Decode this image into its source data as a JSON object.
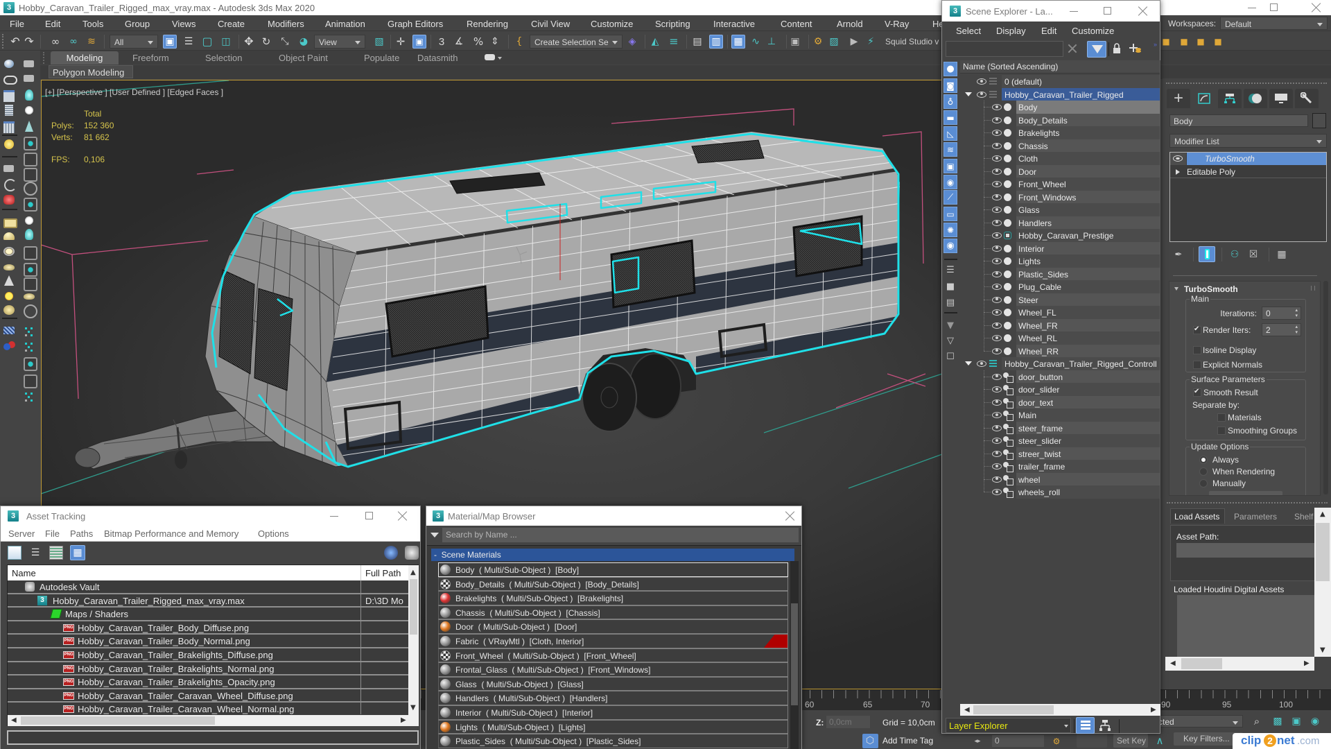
{
  "app": {
    "title": "Hobby_Caravan_Trailer_Rigged_max_vray.max - Autodesk 3ds Max 2020"
  },
  "menu": {
    "items": [
      "File",
      "Edit",
      "Tools",
      "Group",
      "Views",
      "Create",
      "Modifiers",
      "Animation",
      "Graph Editors",
      "Rendering",
      "Civil View",
      "Customize",
      "Scripting",
      "Interactive",
      "Content",
      "Arnold",
      "V-Ray",
      "Help"
    ]
  },
  "workspaces": {
    "label": "Workspaces:",
    "value": "Default"
  },
  "main_toolbar": {
    "selection_filter": "All",
    "reference_coordinate_system": "View",
    "named_selection_set": "Create Selection Se",
    "plugin_label": "Squid Studio v",
    "icons": [
      "undo-icon",
      "redo-icon",
      "select-and-link-icon",
      "unlink-selection-icon",
      "bind-to-space-warp-icon",
      "select-object-icon",
      "select-by-name-icon",
      "rectangular-selection-region-icon",
      "window-crossing-icon",
      "select-and-move-icon",
      "select-and-rotate-icon",
      "select-and-scale-icon",
      "select-and-place-icon",
      "use-pivot-point-center-icon",
      "select-and-manipulate-icon",
      "keyboard-shortcut-override-icon",
      "snaps-toggle-icon",
      "angle-snap-icon",
      "percent-snap-icon",
      "spinner-snap-icon",
      "edit-named-selection-sets-icon",
      "named-selection-icon",
      "mirror-icon",
      "align-icon",
      "toggle-scene-explorer-icon",
      "toggle-layer-explorer-icon",
      "toggle-ribbon-icon",
      "curve-editor-icon",
      "schematic-view-icon",
      "material-editor-icon",
      "render-setup-icon",
      "rendered-frame-window-icon",
      "render-production-icon",
      "render-iterative-icon"
    ],
    "active_icons": [
      "select-object-icon",
      "keyboard-shortcut-override-icon",
      "toggle-layer-explorer-icon",
      "toggle-ribbon-icon"
    ]
  },
  "ribbon": {
    "tabs": [
      "Modeling",
      "Freeform",
      "Selection",
      "Object Paint",
      "Populate",
      "Datasmith"
    ],
    "active_tab": "Modeling",
    "panel_label": "Polygon Modeling"
  },
  "viewport": {
    "label": "[+] [Perspective ] [User Defined ] [Edged Faces ]",
    "stats": {
      "header": "Total",
      "polys_label": "Polys:",
      "polys": "152 360",
      "verts_label": "Verts:",
      "verts": "81 662",
      "fps_label": "FPS:",
      "fps": "0,106"
    },
    "colors": {
      "stats_text": "#d6c44c",
      "selection_outline": "#1fe0e8",
      "active_border": "#c09a34"
    }
  },
  "scene_explorer": {
    "title": "Scene Explorer - La...",
    "menu": [
      "Select",
      "Display",
      "Edit",
      "Customize"
    ],
    "search_value": "",
    "column_header": "Name (Sorted Ascending)",
    "tree": [
      {
        "name": "0 (default)",
        "type": "layer"
      },
      {
        "name": "Hobby_Caravan_Trailer_Rigged",
        "type": "layer",
        "expanded": true,
        "selected": true
      },
      {
        "name": "Body",
        "type": "geometry",
        "highlighted": true
      },
      {
        "name": "Body_Details",
        "type": "geometry"
      },
      {
        "name": "Brakelights",
        "type": "geometry"
      },
      {
        "name": "Chassis",
        "type": "geometry"
      },
      {
        "name": "Cloth",
        "type": "geometry"
      },
      {
        "name": "Door",
        "type": "geometry"
      },
      {
        "name": "Front_Wheel",
        "type": "geometry"
      },
      {
        "name": "Front_Windows",
        "type": "geometry"
      },
      {
        "name": "Glass",
        "type": "geometry"
      },
      {
        "name": "Handlers",
        "type": "geometry"
      },
      {
        "name": "Hobby_Caravan_Prestige",
        "type": "group"
      },
      {
        "name": "Interior",
        "type": "geometry"
      },
      {
        "name": "Lights",
        "type": "geometry"
      },
      {
        "name": "Plastic_Sides",
        "type": "geometry"
      },
      {
        "name": "Plug_Cable",
        "type": "geometry"
      },
      {
        "name": "Steer",
        "type": "geometry"
      },
      {
        "name": "Wheel_FL",
        "type": "geometry"
      },
      {
        "name": "Wheel_FR",
        "type": "geometry"
      },
      {
        "name": "Wheel_RL",
        "type": "geometry"
      },
      {
        "name": "Wheel_RR",
        "type": "geometry"
      },
      {
        "name": "Hobby_Caravan_Trailer_Rigged_Controll",
        "type": "layer",
        "expanded": true
      },
      {
        "name": "door_button",
        "type": "helper"
      },
      {
        "name": "door_slider",
        "type": "helper"
      },
      {
        "name": "door_text",
        "type": "helper"
      },
      {
        "name": "Main",
        "type": "helper"
      },
      {
        "name": "steer_frame",
        "type": "helper"
      },
      {
        "name": "steer_slider",
        "type": "helper"
      },
      {
        "name": "streer_twist",
        "type": "helper"
      },
      {
        "name": "trailer_frame",
        "type": "helper"
      },
      {
        "name": "wheel",
        "type": "helper"
      },
      {
        "name": "wheels_roll",
        "type": "helper"
      }
    ],
    "footer": {
      "explorer_mode": "Layer Explorer",
      "mode_text_color": "#e8e810"
    }
  },
  "command_panel": {
    "tabs": [
      "create",
      "modify",
      "hierarchy",
      "motion",
      "display",
      "utilities"
    ],
    "active_tab": "modify",
    "object_name": "Body",
    "modifier_list": "Modifier List",
    "stack": [
      {
        "name": "TurboSmooth",
        "selected": true
      },
      {
        "name": "Editable Poly",
        "selected": false
      }
    ],
    "turbosmooth": {
      "title": "TurboSmooth",
      "main_label": "Main",
      "iterations_label": "Iterations:",
      "iterations": "0",
      "render_iters_label": "Render Iters:",
      "render_iters": "2",
      "render_iters_enabled": true,
      "isoline_label": "Isoline Display",
      "isoline": false,
      "explicit_normals_label": "Explicit Normals",
      "explicit_normals": false,
      "surface_label": "Surface Parameters",
      "smooth_result_label": "Smooth Result",
      "smooth_result": true,
      "separate_by_label": "Separate by:",
      "materials_label": "Materials",
      "materials": false,
      "smoothing_groups_label": "Smoothing Groups",
      "smoothing_groups": false,
      "update_label": "Update Options",
      "update_options": [
        {
          "label": "Always",
          "selected": true
        },
        {
          "label": "When Rendering",
          "selected": false
        },
        {
          "label": "Manually",
          "selected": false
        }
      ]
    }
  },
  "houdini_engine": {
    "tabs": [
      "Load Assets",
      "Parameters",
      "Shelf"
    ],
    "active_tab": "Load Assets",
    "asset_path_label": "Asset Path:",
    "asset_path_value": "",
    "loaded_assets_label": "Loaded Houdini Digital Assets"
  },
  "timeline": {
    "visible_ticks": [
      "60",
      "65",
      "70",
      "90",
      "95",
      "100"
    ]
  },
  "status_bar": {
    "z_label": "Z:",
    "z_value": "0,0cm",
    "grid": "Grid = 10,0cm",
    "add_time_tag": "Add Time Tag",
    "current_frame": "0",
    "set_key": "Set Key",
    "key_filters": "Key Filters...",
    "key_mode": "Selected"
  },
  "asset_tracking": {
    "title": "Asset Tracking",
    "menu": [
      "Server",
      "File",
      "Paths",
      "Bitmap Performance and Memory",
      "Options"
    ],
    "columns": [
      "Name",
      "Full Path"
    ],
    "rows": [
      {
        "name": "Autodesk Vault",
        "path": "",
        "icon": "vault"
      },
      {
        "name": "Hobby_Caravan_Trailer_Rigged_max_vray.max",
        "path": "D:\\3D Mo",
        "icon": "max-file"
      },
      {
        "name": "Maps / Shaders",
        "path": "",
        "icon": "maps"
      },
      {
        "name": "Hobby_Caravan_Trailer_Body_Diffuse.png",
        "path": "",
        "icon": "png"
      },
      {
        "name": "Hobby_Caravan_Trailer_Body_Normal.png",
        "path": "",
        "icon": "png"
      },
      {
        "name": "Hobby_Caravan_Trailer_Brakelights_Diffuse.png",
        "path": "",
        "icon": "png"
      },
      {
        "name": "Hobby_Caravan_Trailer_Brakelights_Normal.png",
        "path": "",
        "icon": "png"
      },
      {
        "name": "Hobby_Caravan_Trailer_Brakelights_Opacity.png",
        "path": "",
        "icon": "png"
      },
      {
        "name": "Hobby_Caravan_Trailer_Caravan_Wheel_Diffuse.png",
        "path": "",
        "icon": "png"
      },
      {
        "name": "Hobby_Caravan_Trailer_Caravan_Wheel_Normal.png",
        "path": "",
        "icon": "png"
      }
    ],
    "status": ""
  },
  "material_browser": {
    "title": "Material/Map Browser",
    "search_placeholder": "Search by Name ...",
    "group_label": "-  Scene Materials",
    "materials": [
      {
        "text": "Body  ( Multi/Sub-Object )  [Body]",
        "marker": false
      },
      {
        "text": "Body_Details  ( Multi/Sub-Object )  [Body_Details]",
        "marker": false
      },
      {
        "text": "Brakelights  ( Multi/Sub-Object )  [Brakelights]",
        "marker": false
      },
      {
        "text": "Chassis  ( Multi/Sub-Object )  [Chassis]",
        "marker": false
      },
      {
        "text": "Door  ( Multi/Sub-Object )  [Door]",
        "marker": false
      },
      {
        "text": "Fabric  ( VRayMtl )  [Cloth, Interior]",
        "marker": true
      },
      {
        "text": "Front_Wheel  ( Multi/Sub-Object )  [Front_Wheel]",
        "marker": false
      },
      {
        "text": "Frontal_Glass  ( Multi/Sub-Object )  [Front_Windows]",
        "marker": false
      },
      {
        "text": "Glass  ( Multi/Sub-Object )  [Glass]",
        "marker": false
      },
      {
        "text": "Handlers  ( Multi/Sub-Object )  [Handlers]",
        "marker": false
      },
      {
        "text": "Interior  ( Multi/Sub-Object )  [Interior]",
        "marker": false
      },
      {
        "text": "Lights  ( Multi/Sub-Object )  [Lights]",
        "marker": false
      },
      {
        "text": "Plastic_Sides  ( Multi/Sub-Object )  [Plastic_Sides]",
        "marker": false
      }
    ]
  },
  "watermark": {
    "part1": "clip",
    "part2": "2",
    "part3": "net",
    "part4": ".com"
  }
}
